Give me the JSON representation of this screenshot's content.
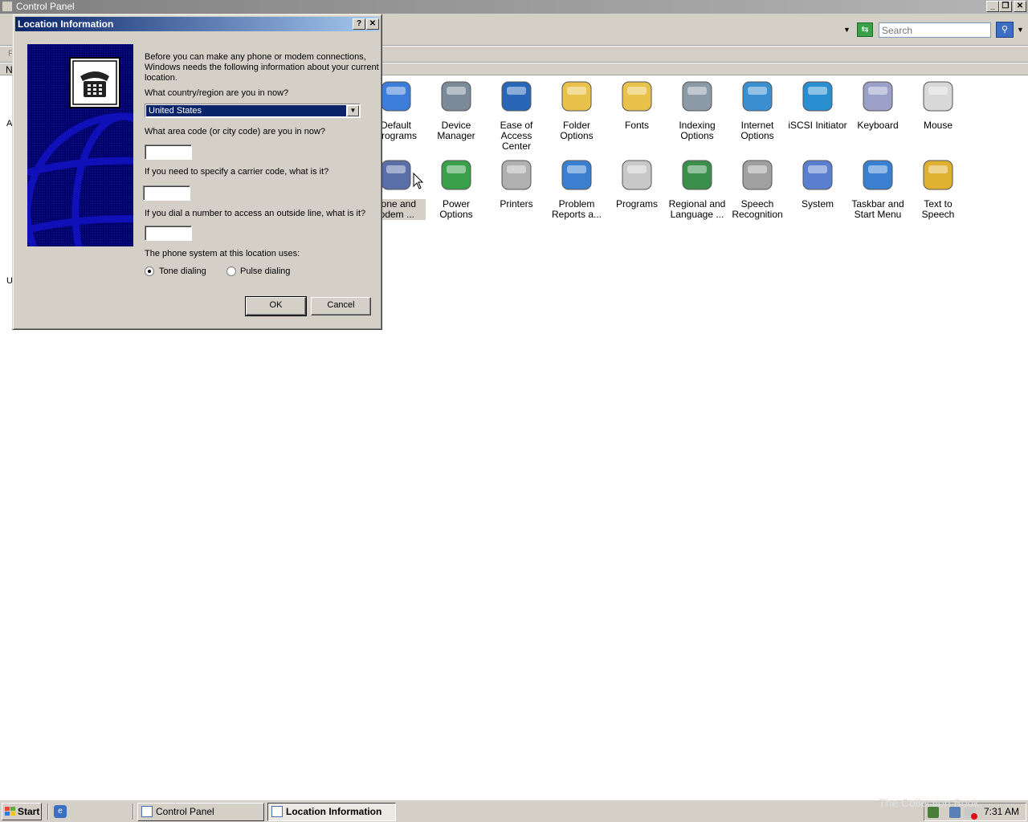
{
  "control_panel": {
    "title": "Control Panel",
    "search_placeholder": "Search",
    "menu_fragment": "F",
    "header_fragment": "N",
    "left_fragment_1": "A",
    "left_fragment_2": "U",
    "items_row1": [
      {
        "label": "Default Programs",
        "display": "Default\nPrograms",
        "icon": "default-programs-icon"
      },
      {
        "label": "Device Manager",
        "display": "Device\nManager",
        "icon": "device-manager-icon"
      },
      {
        "label": "Ease of Access Center",
        "display": "Ease of\nAccess Center",
        "icon": "ease-of-access-icon"
      },
      {
        "label": "Folder Options",
        "display": "Folder Options",
        "icon": "folder-options-icon"
      },
      {
        "label": "Fonts",
        "display": "Fonts",
        "icon": "fonts-icon"
      },
      {
        "label": "Indexing Options",
        "display": "Indexing\nOptions",
        "icon": "indexing-options-icon"
      },
      {
        "label": "Internet Options",
        "display": "Internet\nOptions",
        "icon": "internet-options-icon"
      },
      {
        "label": "iSCSI Initiator",
        "display": "iSCSI Initiator",
        "icon": "iscsi-icon"
      },
      {
        "label": "Keyboard",
        "display": "Keyboard",
        "icon": "keyboard-icon"
      },
      {
        "label": "Mouse",
        "display": "Mouse",
        "icon": "mouse-icon"
      }
    ],
    "items_row2": [
      {
        "label": "Phone and Modem ...",
        "display": "hone and\nlodem ...",
        "icon": "phone-modem-icon"
      },
      {
        "label": "Power Options",
        "display": "Power Options",
        "icon": "power-options-icon"
      },
      {
        "label": "Printers",
        "display": "Printers",
        "icon": "printers-icon"
      },
      {
        "label": "Problem Reports a...",
        "display": "Problem\nReports a...",
        "icon": "problem-reports-icon"
      },
      {
        "label": "Programs",
        "display": "Programs",
        "icon": "programs-icon"
      },
      {
        "label": "Regional and Language ...",
        "display": "Regional and\nLanguage ...",
        "icon": "regional-language-icon"
      },
      {
        "label": "Speech Recognition",
        "display": "Speech\nRecognition",
        "icon": "speech-recognition-icon"
      },
      {
        "label": "System",
        "display": "System",
        "icon": "system-icon"
      },
      {
        "label": "Taskbar and Start Menu",
        "display": "Taskbar and\nStart Menu",
        "icon": "taskbar-start-menu-icon"
      },
      {
        "label": "Text to Speech",
        "display": "Text to\nSpeech",
        "icon": "text-to-speech-icon"
      }
    ]
  },
  "dialog": {
    "title": "Location Information",
    "help_label": "?",
    "intro": "Before you can make any phone or modem connections, Windows needs the following information about your current location.",
    "intro_lines": [
      "Before you can make any phone or modem connections,",
      "Windows needs the following information about your current",
      "location."
    ],
    "country_question": "What country/region are you in now?",
    "country_value": "United States",
    "area_code_question": "What area code (or city code) are you in now?",
    "area_code_value": "",
    "carrier_question": "If you need to specify a carrier code, what is it?",
    "carrier_value": "",
    "outside_line_question": "If you dial a number to access an outside line, what is it?",
    "outside_line_value": "",
    "phone_system_label": "The phone system at this location uses:",
    "tone_label": "Tone dialing",
    "pulse_label": "Pulse dialing",
    "selected_dialing": "Tone dialing",
    "ok_label": "OK",
    "cancel_label": "Cancel"
  },
  "taskbar": {
    "start_label": "Start",
    "tasks": [
      {
        "label": "Control Panel",
        "active": false
      },
      {
        "label": "Location Information",
        "active": true
      }
    ],
    "clock": "7:31 AM",
    "watermark": "The Collection Book"
  }
}
